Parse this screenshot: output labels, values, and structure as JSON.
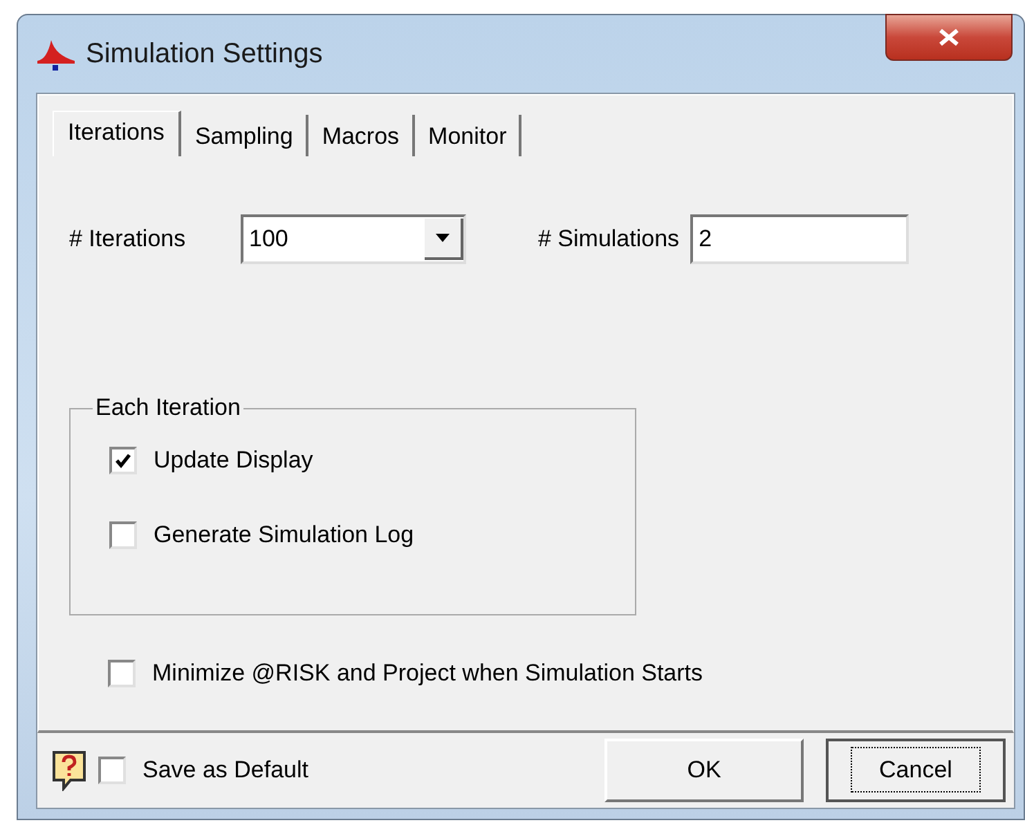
{
  "window": {
    "title": "Simulation Settings"
  },
  "tabs": [
    {
      "label": "Iterations",
      "selected": true
    },
    {
      "label": "Sampling",
      "selected": false
    },
    {
      "label": "Macros",
      "selected": false
    },
    {
      "label": "Monitor",
      "selected": false
    }
  ],
  "iterations": {
    "label": "# Iterations",
    "value": "100"
  },
  "simulations": {
    "label": "# Simulations",
    "value": "2"
  },
  "group": {
    "title": "Each Iteration",
    "options": [
      {
        "label": "Update Display",
        "checked": true
      },
      {
        "label": "Generate Simulation Log",
        "checked": false
      }
    ]
  },
  "minimize": {
    "label": "Minimize @RISK and Project when Simulation Starts",
    "checked": false
  },
  "footer": {
    "save_default": {
      "label": "Save as Default",
      "checked": false
    },
    "buttons": [
      {
        "label": "OK",
        "focused": false
      },
      {
        "label": "Cancel",
        "focused": true
      }
    ]
  }
}
